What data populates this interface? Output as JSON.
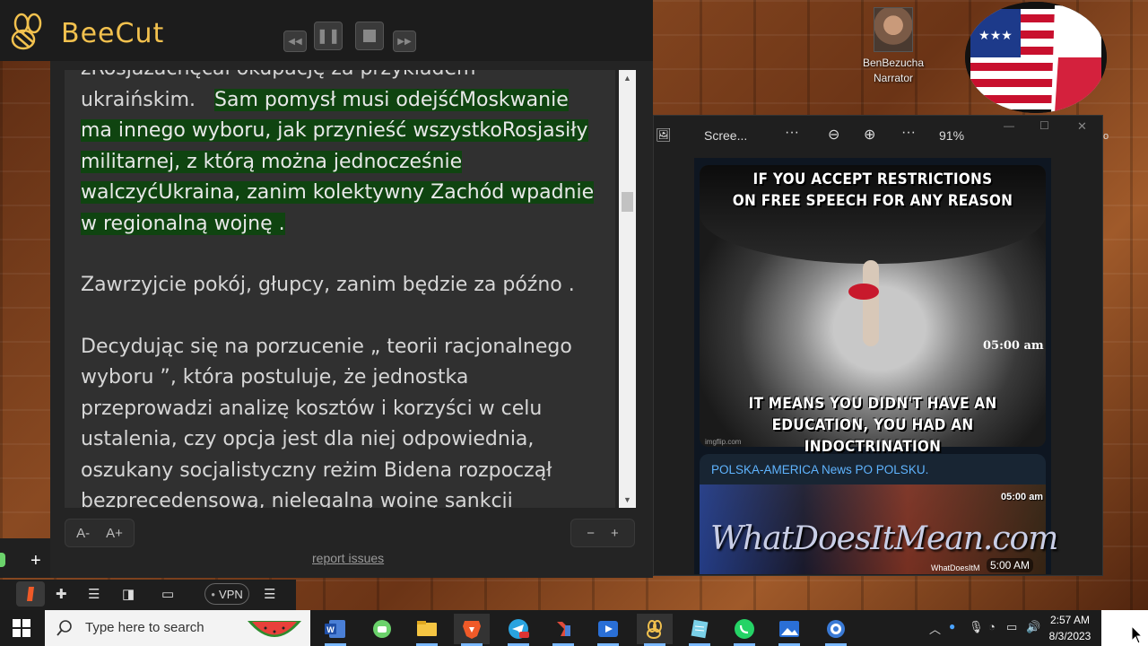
{
  "beecut": {
    "title": "BeeCut"
  },
  "reader": {
    "partial_line": "zRosjazachęcał okupację za przykładem",
    "lines_a": [
      "ukraińskim."
    ],
    "highlight_lines": [
      "Sam pomysł musi odejśćMoskwanie",
      "ma innego wyboru, jak przynieść wszystkoRosjasiły",
      "militarnej, z którą można jednocześnie",
      "walczyćUkraina, zanim kolektywny Zachód wpadnie",
      "w regionalną wojnę ."
    ],
    "para2": "Zawrzyjcie pokój, głupcy, zanim będzie za późno .",
    "para3": [
      "Decydując się na porzucenie „ teorii racjonalnego",
      "wyboru ”, która postuluje, że jednostka",
      "przeprowadzi analizę kosztów i korzyści w celu",
      "ustalenia, czy opcja jest dla niej odpowiednia,",
      "oszukany socjalistyczny reżim Bidena rozpoczął",
      "bezprecedensową, nielegalną wojnę sankcji"
    ],
    "font_smaller": "A-",
    "font_larger": "A+",
    "speed_minus": "−",
    "speed_plus": "+",
    "report_issues": "report issues"
  },
  "narrator": {
    "name": "BenBezucha",
    "role": "Narrator"
  },
  "viewer": {
    "title": "Scree...",
    "more1": "···",
    "more2": "···",
    "zoom": "91%",
    "minimize": "—",
    "maximize": "☐",
    "close": "✕",
    "edge_letter": "o"
  },
  "telegram": {
    "meme_top": [
      "IF YOU ACCEPT RESTRICTIONS",
      "ON FREE SPEECH FOR ANY REASON"
    ],
    "meme_bottom": [
      "IT MEANS YOU DIDN'T HAVE AN",
      "EDUCATION, YOU HAD AN INDOCTRINATION"
    ],
    "meme_time": "05:00 am",
    "meme_watermark": "imgflip.com",
    "channel": "POLSKA-AMERICA News PO POLSKU.",
    "wd_logo": "WhatDoesItMean.com",
    "wd_time_top": "05:00 am",
    "wd_small": "WhatDoesItM",
    "wd_time_bottom": "5:00 AM"
  },
  "browser": {
    "vpn": "VPN",
    "new_tab": "+"
  },
  "taskbar": {
    "search_placeholder": "Type here to search",
    "time": "2:57 AM",
    "date": "8/3/2023",
    "apps": [
      "word-icon",
      "android-icon",
      "file-explorer-icon",
      "brave-icon",
      "telegram-icon",
      "tool-icon",
      "media-player-icon",
      "beecut-icon",
      "notepad-icon",
      "whatsapp-icon",
      "photos-icon",
      "media-icon"
    ]
  },
  "colors": {
    "highlight": "#0f4410",
    "beecut_yellow": "#f2c14e",
    "channel_blue": "#5fb4ff"
  }
}
